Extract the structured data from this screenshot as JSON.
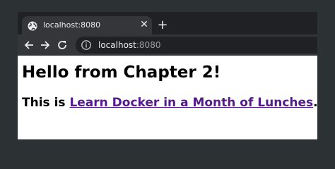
{
  "browser": {
    "tab": {
      "title": "localhost:8080",
      "favicon": "globe-icon",
      "close_icon": "close-icon"
    },
    "new_tab_icon": "plus-icon",
    "nav": {
      "back_icon": "arrow-left-icon",
      "forward_icon": "arrow-right-icon",
      "reload_icon": "reload-icon"
    },
    "address": {
      "host": "localhost",
      "port": ":8080",
      "info_icon": "info-icon"
    }
  },
  "page": {
    "heading": "Hello from Chapter 2!",
    "text_before": "This is ",
    "link_text": "Learn Docker in a Month of Lunches",
    "text_after": "."
  },
  "colors": {
    "tabstrip": "#202124",
    "toolbar": "#35363a",
    "link_visited": "#551a8b"
  }
}
